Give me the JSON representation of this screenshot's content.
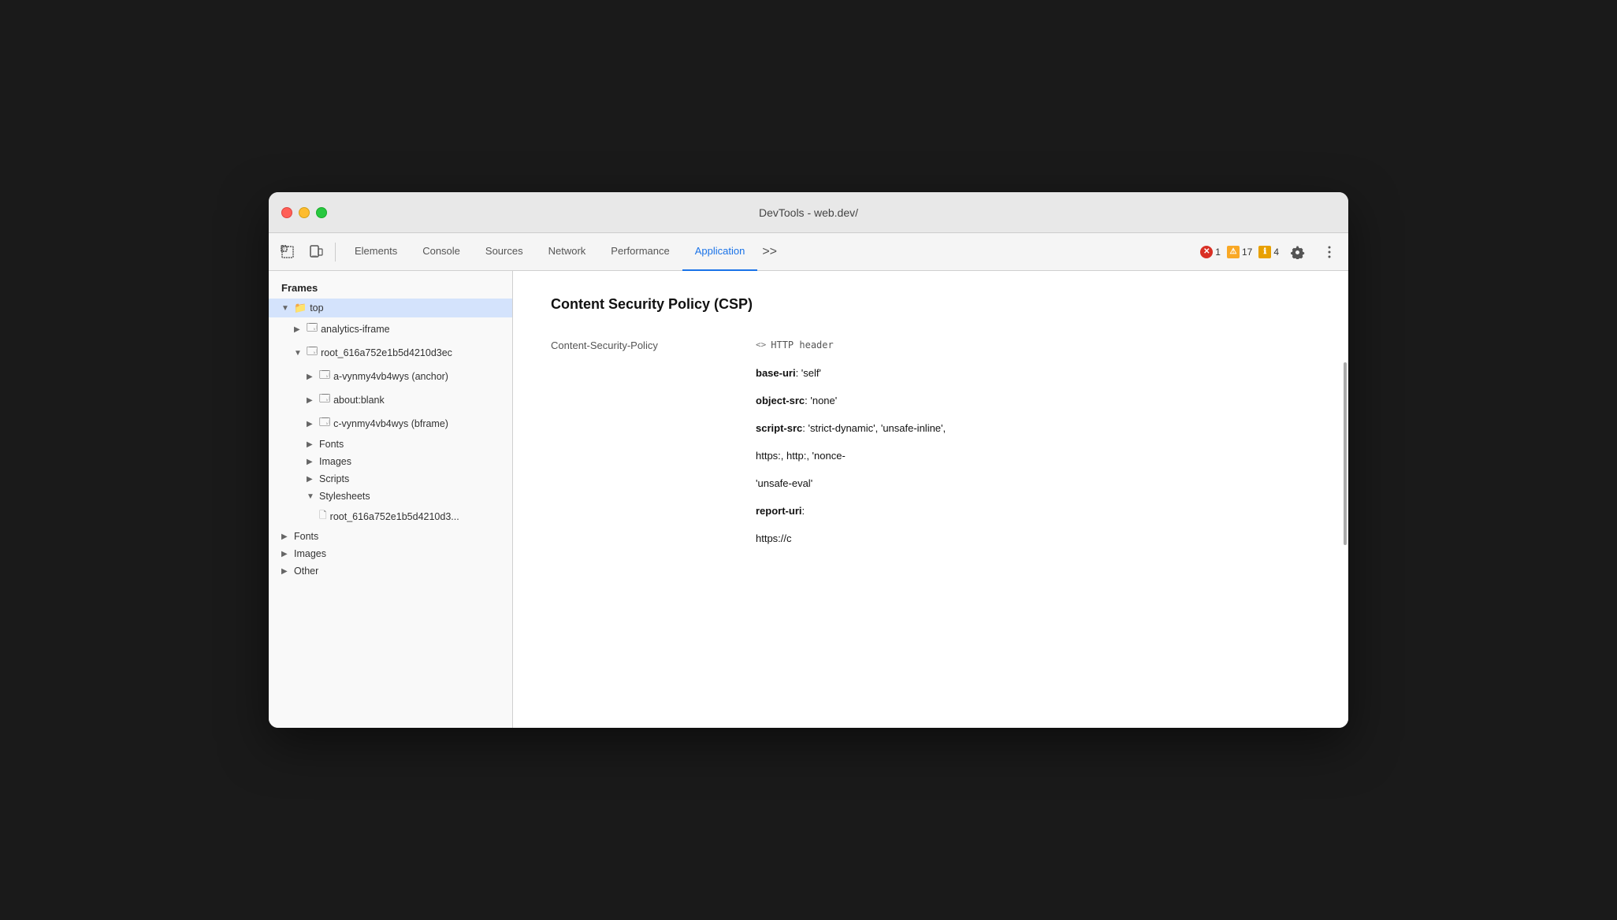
{
  "window": {
    "title": "DevTools - web.dev/"
  },
  "toolbar": {
    "inspect_label": "Inspect",
    "device_label": "Device",
    "tabs": [
      {
        "id": "elements",
        "label": "Elements",
        "active": false
      },
      {
        "id": "console",
        "label": "Console",
        "active": false
      },
      {
        "id": "sources",
        "label": "Sources",
        "active": false
      },
      {
        "id": "network",
        "label": "Network",
        "active": false
      },
      {
        "id": "performance",
        "label": "Performance",
        "active": false
      },
      {
        "id": "application",
        "label": "Application",
        "active": true
      }
    ],
    "more_tabs": ">>",
    "errors": {
      "count": "1",
      "icon": "✕"
    },
    "warnings": {
      "count": "17",
      "icon": "⚠"
    },
    "info": {
      "count": "4",
      "icon": "ℹ"
    }
  },
  "sidebar": {
    "section_label": "Frames",
    "items": [
      {
        "id": "top",
        "label": "top",
        "level": 1,
        "type": "folder",
        "open": true,
        "selected": true
      },
      {
        "id": "analytics-iframe",
        "label": "analytics-iframe",
        "level": 2,
        "type": "folder",
        "open": false
      },
      {
        "id": "root_616a",
        "label": "root_616a752e1b5d4210d3ec",
        "level": 2,
        "type": "folder",
        "open": true
      },
      {
        "id": "a-vynmy",
        "label": "a-vynmy4vb4wys (anchor)",
        "level": 3,
        "type": "folder",
        "open": false
      },
      {
        "id": "about-blank",
        "label": "about:blank",
        "level": 3,
        "type": "folder",
        "open": false
      },
      {
        "id": "c-vynmy",
        "label": "c-vynmy4vb4wys (bframe)",
        "level": 3,
        "type": "folder",
        "open": false
      },
      {
        "id": "fonts-inner",
        "label": "Fonts",
        "level": 3,
        "type": "folder-leaf",
        "open": false
      },
      {
        "id": "images-inner",
        "label": "Images",
        "level": 3,
        "type": "folder-leaf",
        "open": false
      },
      {
        "id": "scripts-inner",
        "label": "Scripts",
        "level": 3,
        "type": "folder-leaf",
        "open": false
      },
      {
        "id": "stylesheets-inner",
        "label": "Stylesheets",
        "level": 3,
        "type": "folder",
        "open": true
      },
      {
        "id": "stylesheet-file",
        "label": "root_616a752e1b5d4210d3...",
        "level": 4,
        "type": "file"
      },
      {
        "id": "fonts",
        "label": "Fonts",
        "level": 1,
        "type": "folder-leaf",
        "open": false
      },
      {
        "id": "images",
        "label": "Images",
        "level": 1,
        "type": "folder-leaf",
        "open": false
      },
      {
        "id": "other",
        "label": "Other",
        "level": 1,
        "type": "folder-leaf",
        "open": false
      }
    ]
  },
  "content": {
    "title": "Content Security Policy (CSP)",
    "policy_key": "Content-Security-Policy",
    "policy_source": "HTTP header",
    "directives": [
      {
        "key": "base-uri",
        "value": ": 'self'"
      },
      {
        "key": "object-src",
        "value": ": 'none'"
      },
      {
        "key": "script-src",
        "value": ": 'strict-dynamic', 'unsafe-inline',"
      },
      {
        "key": "",
        "value": "https:, http:, 'nonce-"
      },
      {
        "key": "",
        "value": ""
      },
      {
        "key": "",
        "value": "'unsafe-eval'"
      },
      {
        "key": "report-uri",
        "value": ":"
      },
      {
        "key": "",
        "value": "https://c"
      }
    ]
  }
}
